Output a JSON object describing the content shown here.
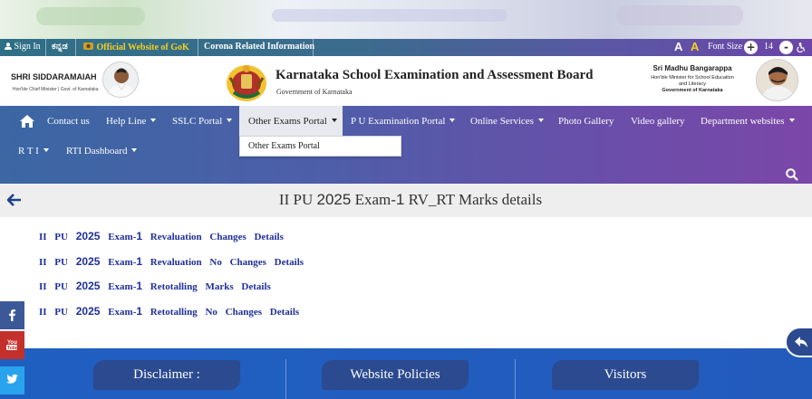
{
  "topbar": {
    "sign_in": "Sign In",
    "kannada": "ಕನ್ನಡ",
    "gok": "Official Website of GoK",
    "corona": "Corona Related Information",
    "font_a": "A",
    "font_a2": "A",
    "font_size_label": "Font Size",
    "font_plus": "+",
    "font_value": "14",
    "font_minus": "-"
  },
  "header": {
    "cm_name": "SHRI SIDDARAMAIAH",
    "cm_sub": "Hon'ble Chief Minister | Govt. of Karnataka",
    "board_title": "Karnataka School Examination and Assessment Board",
    "board_sub": "Government of Karnataka",
    "minister_name": "Sri Madhu Bangarappa",
    "minister_line1": "Hon'ble Minister for School Education",
    "minister_line2": "and Literacy",
    "minister_line3": "Government of Karnataka"
  },
  "nav": {
    "items": [
      {
        "label": "Contact us"
      },
      {
        "label": "Help Line"
      },
      {
        "label": "SSLC Portal"
      },
      {
        "label": "Other Exams Portal"
      },
      {
        "label": "P U Examination Portal"
      },
      {
        "label": "Online Services"
      },
      {
        "label": "Photo Gallery"
      },
      {
        "label": "Video gallery"
      },
      {
        "label": "Department websites"
      },
      {
        "label": "R T I"
      },
      {
        "label": "RTI Dashboard"
      }
    ],
    "dropdown_item": "Other Exams Portal"
  },
  "page": {
    "title_prefix": "II PU ",
    "title_year": "2025",
    "title_mid": " Exam-",
    "title_num": "1",
    "title_suffix": " RV_RT Marks details"
  },
  "links": [
    {
      "prefix": "II PU",
      "year": "2025",
      "exam": "Exam-",
      "num": "1",
      "text": "Revaluation Changes Details"
    },
    {
      "prefix": "II PU",
      "year": "2025",
      "exam": "Exam-",
      "num": "1",
      "text": "Revaluation No Changes Details"
    },
    {
      "prefix": "II PU",
      "year": "2025",
      "exam": "Exam-",
      "num": "1",
      "text": "Retotalling Marks Details"
    },
    {
      "prefix": "II PU",
      "year": "2025",
      "exam": "Exam-",
      "num": "1",
      "text": "Retotalling No Changes Details"
    }
  ],
  "footer": {
    "disclaimer": "Disclaimer :",
    "policies": "Website Policies",
    "visitors": "Visitors"
  },
  "colors": {
    "accent": "#1f2f9a",
    "gok_yellow": "#f5d020",
    "nav_start": "#3b67a3",
    "nav_end": "#7b47a9",
    "footer": "#235bbd"
  }
}
